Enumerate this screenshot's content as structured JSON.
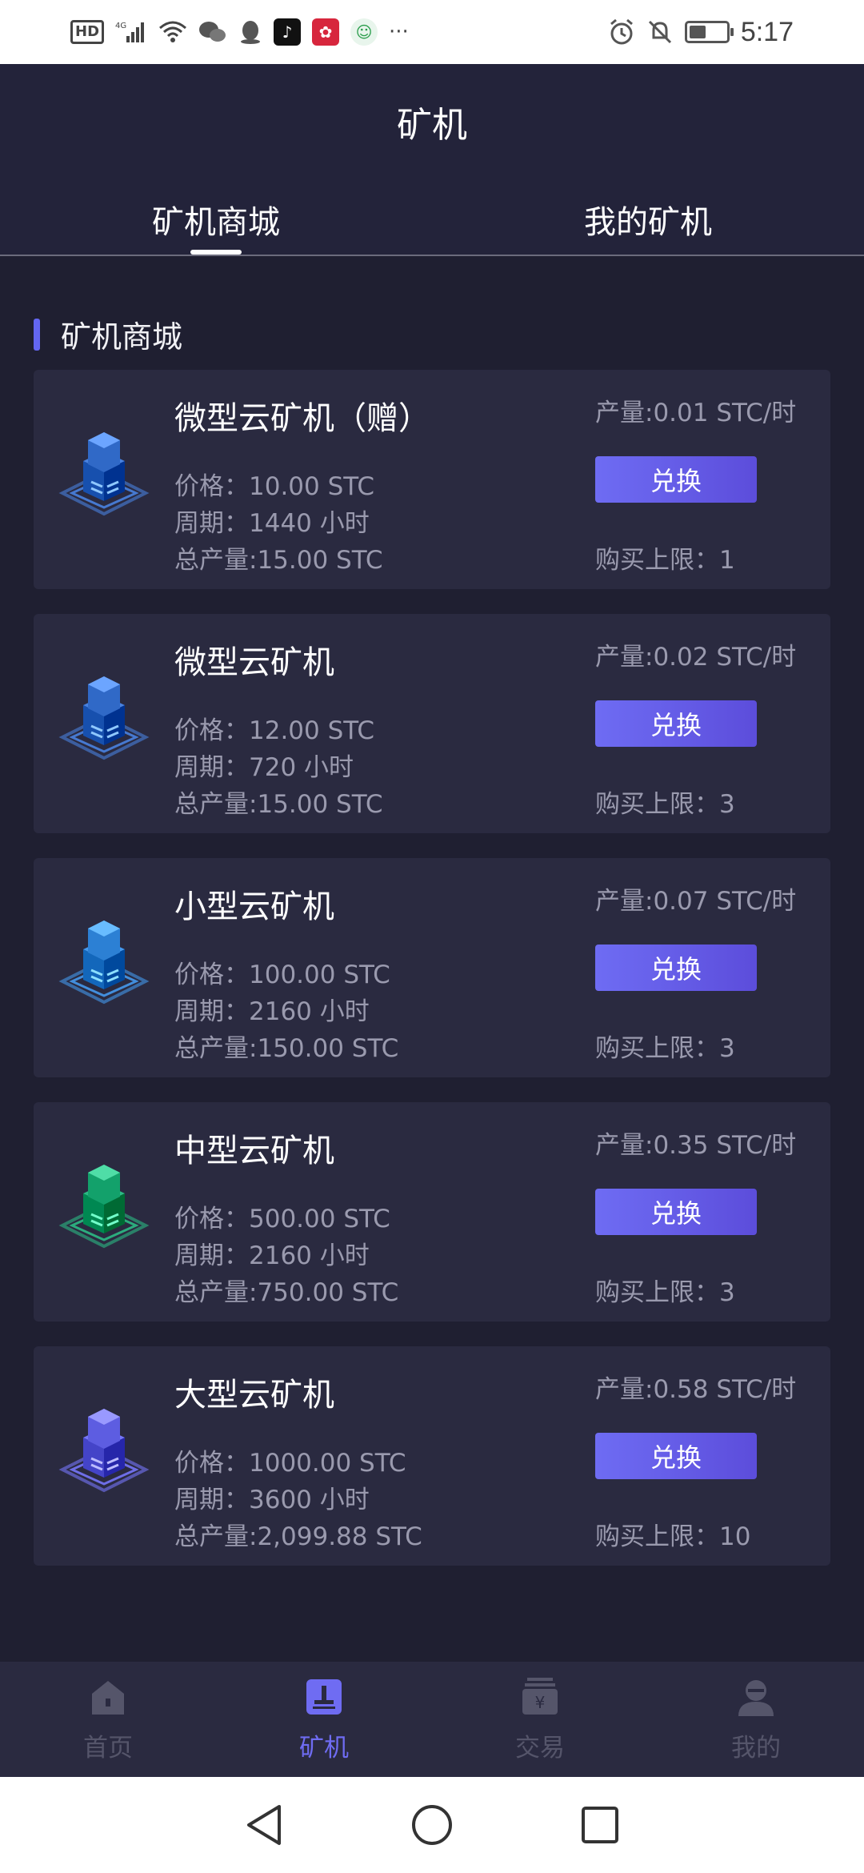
{
  "status_bar": {
    "left_icons": [
      "HD",
      "4G",
      "signal",
      "wifi",
      "wechat",
      "qq",
      "tiktok",
      "app-red",
      "app-green",
      "..."
    ],
    "time": "5:17"
  },
  "header": {
    "title": "矿机",
    "tabs": [
      {
        "label": "矿机商城",
        "active": true
      },
      {
        "label": "我的矿机",
        "active": false
      }
    ]
  },
  "section": {
    "title": "矿机商城"
  },
  "machines": [
    {
      "name": "微型云矿机（赠）",
      "price": "价格：10.00 STC",
      "period": "周期：1440 小时",
      "total": "总产量:15.00 STC",
      "output": "产量:0.01 STC/时",
      "button": "兑换",
      "limit": "购买上限：1",
      "color": "#3f78d6",
      "icon": "server-cube-icon"
    },
    {
      "name": "微型云矿机",
      "price": "价格：12.00 STC",
      "period": "周期：720 小时",
      "total": "总产量:15.00 STC",
      "output": "产量:0.02 STC/时",
      "button": "兑换",
      "limit": "购买上限：3",
      "color": "#3f78d6",
      "icon": "server-cube-icon"
    },
    {
      "name": "小型云矿机",
      "price": "价格：100.00 STC",
      "period": "周期：2160 小时",
      "total": "总产量:150.00 STC",
      "output": "产量:0.07 STC/时",
      "button": "兑换",
      "limit": "购买上限：3",
      "color": "#3b8fe3",
      "icon": "server-cube-icon"
    },
    {
      "name": "中型云矿机",
      "price": "价格：500.00 STC",
      "period": "周期：2160 小时",
      "total": "总产量:750.00 STC",
      "output": "产量:0.35 STC/时",
      "button": "兑换",
      "limit": "购买上限：3",
      "color": "#22b07a",
      "icon": "server-cube-icon"
    },
    {
      "name": "大型云矿机",
      "price": "价格：1000.00 STC",
      "period": "周期：3600 小时",
      "total": "总产量:2,099.88 STC",
      "output": "产量:0.58 STC/时",
      "button": "兑换",
      "limit": "购买上限：10",
      "color": "#6c6cf0",
      "icon": "server-cube-icon"
    }
  ],
  "bottom_nav": [
    {
      "label": "首页",
      "icon": "home-icon",
      "active": false
    },
    {
      "label": "矿机",
      "icon": "miner-icon",
      "active": true
    },
    {
      "label": "交易",
      "icon": "trade-icon",
      "active": false
    },
    {
      "label": "我的",
      "icon": "profile-icon",
      "active": false
    }
  ],
  "colors": {
    "accent": "#6366f1",
    "background": "#1f1f31",
    "card": "#2a2a40"
  }
}
